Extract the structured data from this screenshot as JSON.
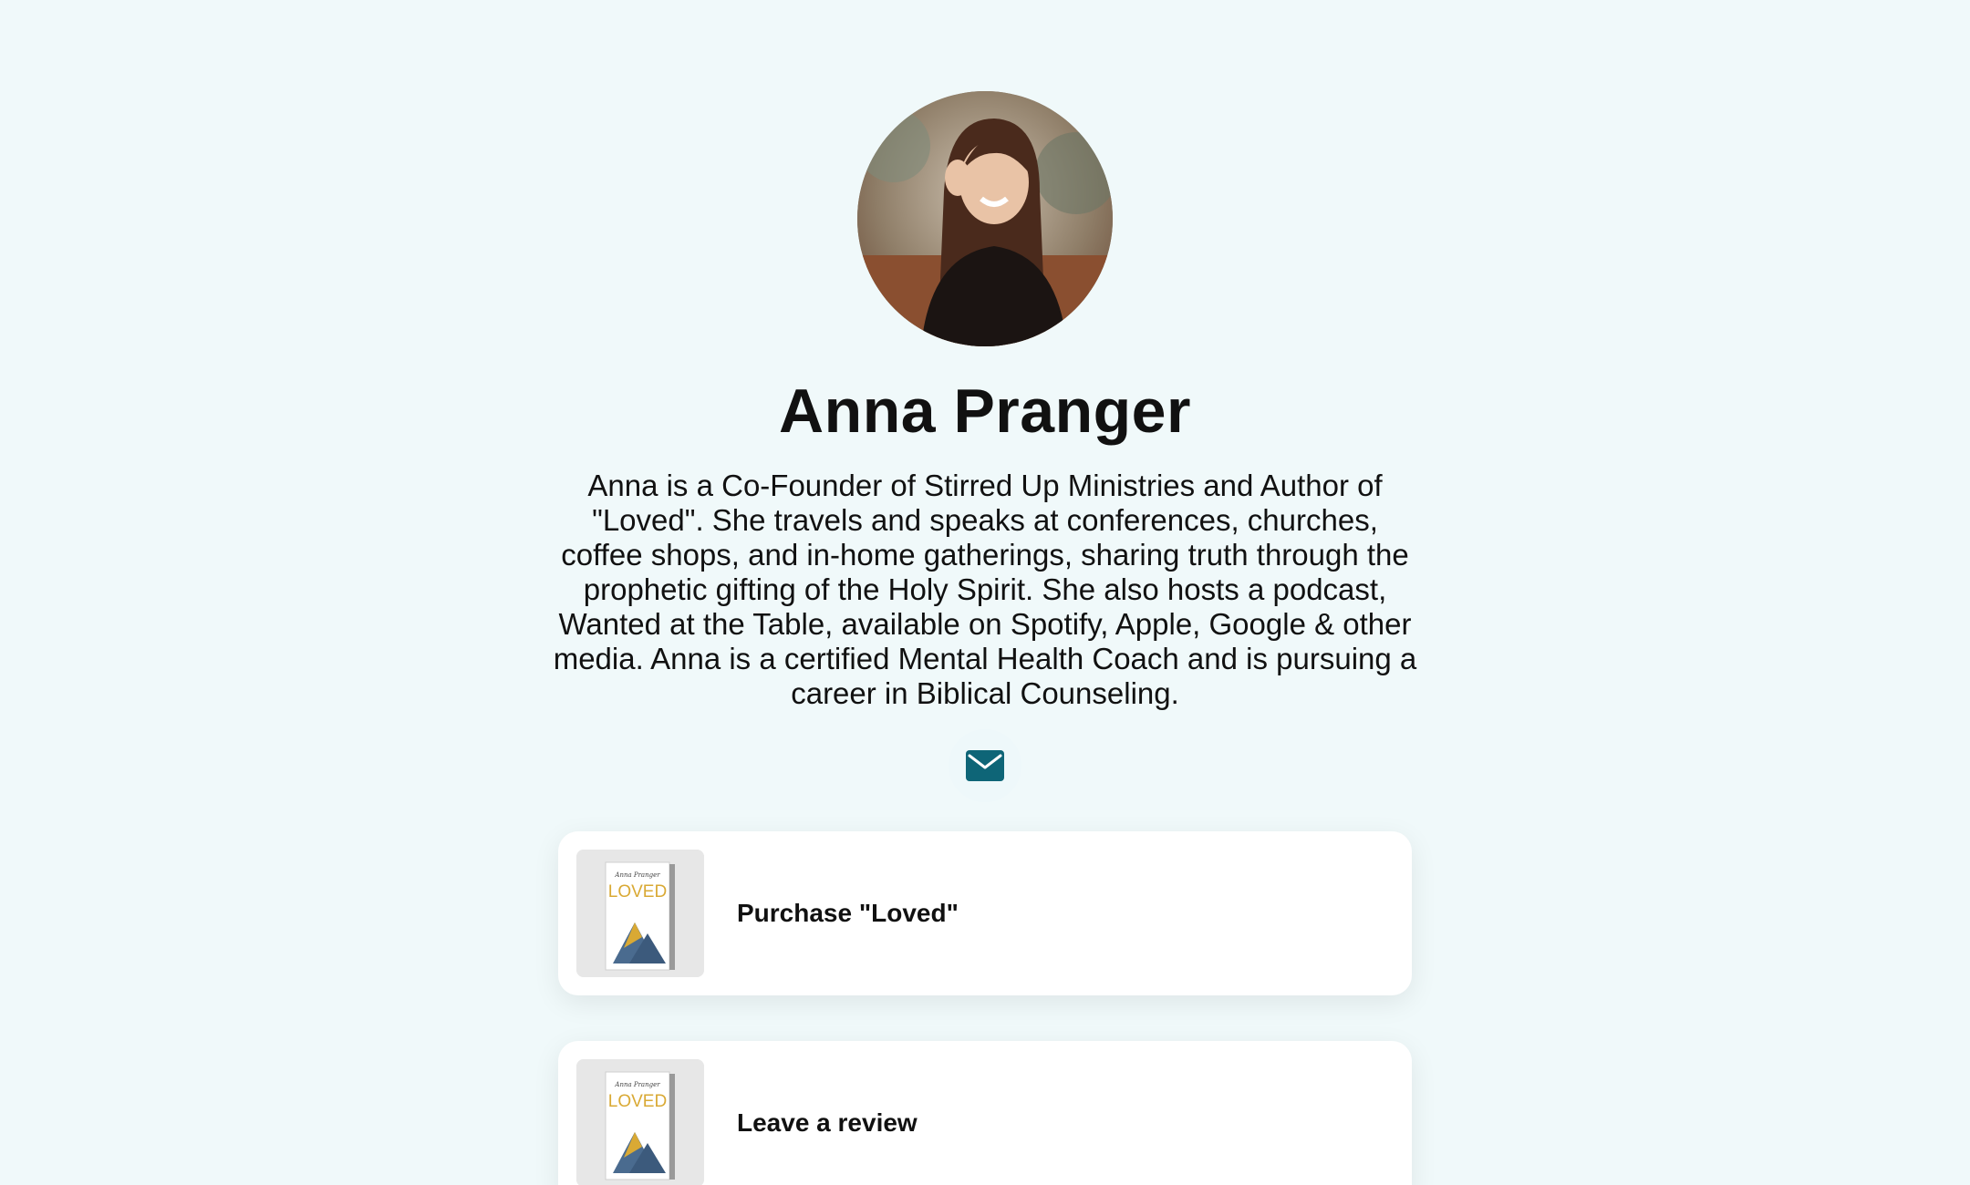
{
  "profile": {
    "name": "Anna Pranger",
    "bio": "Anna is a Co-Founder of Stirred Up Ministries and Author of \"Loved\". She travels and speaks at conferences, churches, coffee shops, and in-home gatherings, sharing truth through the prophetic gifting of the Holy Spirit. She also hosts a podcast, Wanted at the Table, available on Spotify, Apple, Google & other media. Anna is a certified Mental Health Coach and is pursuing a career in Biblical Counseling.",
    "avatar_icon": "profile-photo"
  },
  "social": {
    "email_icon": "envelope-icon",
    "accent": "#0e6577"
  },
  "links": [
    {
      "label": "Purchase \"Loved\"",
      "thumb_title": "LOVED",
      "thumb_author": "Anna Pranger"
    },
    {
      "label": "Leave a review",
      "thumb_title": "LOVED",
      "thumb_author": "Anna Pranger"
    }
  ],
  "colors": {
    "background": "#f0f9fa",
    "card": "#ffffff",
    "book_title": "#d9a934",
    "book_mountain": "#4a6b8f"
  }
}
